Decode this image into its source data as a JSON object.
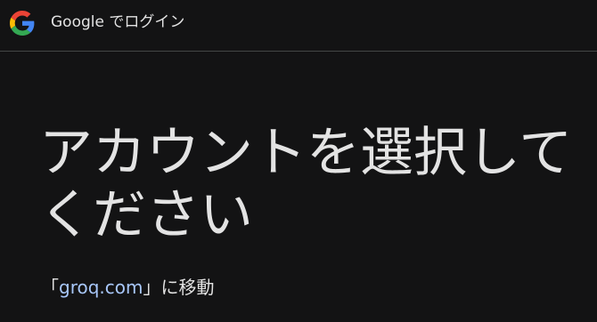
{
  "header": {
    "logo_icon": "google-g-icon",
    "title": "Google でログイン"
  },
  "main": {
    "title": "アカウントを選択してください",
    "subtitle": {
      "prefix": "「",
      "link_text": "groq.com",
      "suffix": "」に移動"
    }
  },
  "colors": {
    "background": "#131314",
    "text": "#e3e3e3",
    "link": "#a8c7fa",
    "divider": "#444746"
  }
}
